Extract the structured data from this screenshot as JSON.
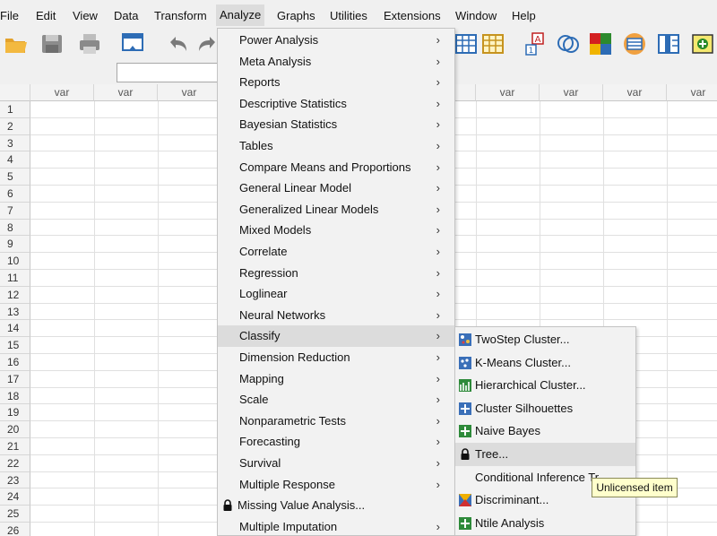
{
  "menubar": {
    "items": [
      "File",
      "Edit",
      "View",
      "Data",
      "Transform",
      "Analyze",
      "Graphs",
      "Utilities",
      "Extensions",
      "Window",
      "Help"
    ],
    "active": "Analyze"
  },
  "toolbar": {
    "icons": [
      "open-folder-icon",
      "save-icon",
      "print-icon",
      "dialog-recall-icon",
      "undo-icon",
      "redo-icon",
      "data-view-icon",
      "split-file-icon",
      "value-labels-icon",
      "sets-icon",
      "color-blocks-icon",
      "weight-cases-icon",
      "insert-variable-icon",
      "add-icon"
    ]
  },
  "grid": {
    "column_header": "var",
    "rows": [
      "1",
      "2",
      "3",
      "4",
      "5",
      "6",
      "7",
      "8",
      "9",
      "10",
      "11",
      "12",
      "13",
      "14",
      "15",
      "16",
      "17",
      "18",
      "19",
      "20",
      "21",
      "22",
      "23",
      "24",
      "25",
      "26"
    ]
  },
  "analyze_menu": {
    "items": [
      {
        "label": "Power Analysis",
        "submenu": true
      },
      {
        "label": "Meta Analysis",
        "submenu": true
      },
      {
        "label": "Reports",
        "submenu": true
      },
      {
        "label": "Descriptive Statistics",
        "submenu": true
      },
      {
        "label": "Bayesian Statistics",
        "submenu": true
      },
      {
        "label": "Tables",
        "submenu": true
      },
      {
        "label": "Compare Means and Proportions",
        "submenu": true
      },
      {
        "label": "General Linear Model",
        "submenu": true
      },
      {
        "label": "Generalized Linear Models",
        "submenu": true
      },
      {
        "label": "Mixed Models",
        "submenu": true
      },
      {
        "label": "Correlate",
        "submenu": true
      },
      {
        "label": "Regression",
        "submenu": true
      },
      {
        "label": "Loglinear",
        "submenu": true
      },
      {
        "label": "Neural Networks",
        "submenu": true
      },
      {
        "label": "Classify",
        "submenu": true
      },
      {
        "label": "Dimension Reduction",
        "submenu": true
      },
      {
        "label": "Mapping",
        "submenu": true
      },
      {
        "label": "Scale",
        "submenu": true
      },
      {
        "label": "Nonparametric Tests",
        "submenu": true
      },
      {
        "label": "Forecasting",
        "submenu": true
      },
      {
        "label": "Survival",
        "submenu": true
      },
      {
        "label": "Multiple Response",
        "submenu": true
      },
      {
        "label": "Missing Value Analysis...",
        "submenu": false,
        "locked": true
      },
      {
        "label": "Multiple Imputation",
        "submenu": true
      }
    ],
    "highlighted": "Classify"
  },
  "classify_submenu": {
    "items": [
      {
        "label": "TwoStep Cluster...",
        "icon": "twostep-cluster-icon"
      },
      {
        "label": "K-Means Cluster...",
        "icon": "kmeans-cluster-icon"
      },
      {
        "label": "Hierarchical Cluster...",
        "icon": "hierarchical-cluster-icon"
      },
      {
        "label": "Cluster Silhouettes",
        "icon": "cluster-silhouettes-icon"
      },
      {
        "label": "Naive Bayes",
        "icon": "naive-bayes-icon"
      },
      {
        "label": "Tree...",
        "icon": "lock-icon"
      },
      {
        "label": "Conditional Inference Tr",
        "icon": ""
      },
      {
        "label": "Discriminant...",
        "icon": "discriminant-icon"
      },
      {
        "label": "Ntile Analysis",
        "icon": "ntile-analysis-icon"
      }
    ],
    "highlighted": "Tree..."
  },
  "tooltip": {
    "text": "Unlicensed item"
  }
}
